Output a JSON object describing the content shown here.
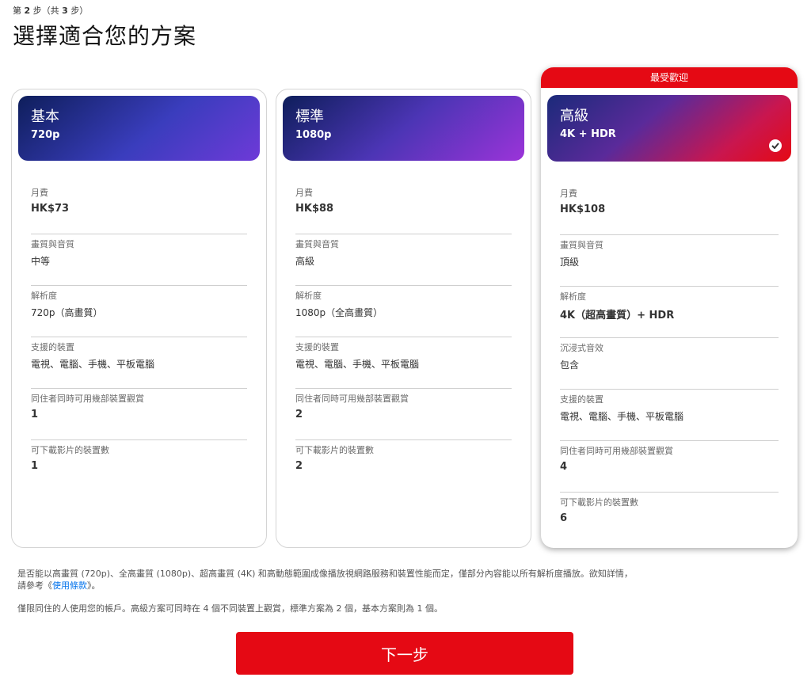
{
  "header": {
    "step_prefix": "第",
    "step_current": "2",
    "step_mid": "步（共",
    "step_total": "3",
    "step_suffix": "步）",
    "title": "選擇適合您的方案"
  },
  "plans": [
    {
      "name": "基本",
      "resolution": "720p",
      "features": [
        {
          "label": "月費",
          "value": "HK$73"
        },
        {
          "label": "畫質與音質",
          "value": "中等"
        },
        {
          "label": "解析度",
          "value": "720p（高畫質）"
        },
        {
          "label": "支援的裝置",
          "value": "電視、電腦、手機、平板電腦"
        },
        {
          "label": "同住者同時可用幾部裝置觀賞",
          "value": "1"
        },
        {
          "label": "可下載影片的裝置數",
          "value": "1"
        }
      ]
    },
    {
      "name": "標準",
      "resolution": "1080p",
      "features": [
        {
          "label": "月費",
          "value": "HK$88"
        },
        {
          "label": "畫質與音質",
          "value": "高級"
        },
        {
          "label": "解析度",
          "value": "1080p（全高畫質）"
        },
        {
          "label": "支援的裝置",
          "value": "電視、電腦、手機、平板電腦"
        },
        {
          "label": "同住者同時可用幾部裝置觀賞",
          "value": "2"
        },
        {
          "label": "可下載影片的裝置數",
          "value": "2"
        }
      ]
    },
    {
      "name": "高級",
      "resolution": "4K + HDR",
      "badge": "最受歡迎",
      "selected": true,
      "features": [
        {
          "label": "月費",
          "value": "HK$108"
        },
        {
          "label": "畫質與音質",
          "value": "頂級"
        },
        {
          "label": "解析度",
          "value": "4K（超高畫質）+ HDR"
        },
        {
          "label": "沉浸式音效",
          "value": "包含"
        },
        {
          "label": "支援的裝置",
          "value": "電視、電腦、手機、平板電腦"
        },
        {
          "label": "同住者同時可用幾部裝置觀賞",
          "value": "4"
        },
        {
          "label": "可下載影片的裝置數",
          "value": "6"
        }
      ]
    }
  ],
  "footnotes": {
    "line1_a": "是否能以高畫質 (720p)、全高畫質 (1080p)、超高畫質 (4K) 和高動態範圍成像播放視網路服務和裝置性能而定，僅部分內容能以所有解析度播放。欲知詳情，",
    "line1_b": "請參考《",
    "terms_link": "使用條款",
    "line1_c": "》。",
    "line2": "僅限同住的人使用您的帳戶。高級方案可同時在 4 個不同裝置上觀賞，標準方案為 2 個，基本方案則為 1 個。"
  },
  "next_button": "下一步",
  "colors": {
    "accent": "#e50914",
    "link": "#0071eb"
  }
}
